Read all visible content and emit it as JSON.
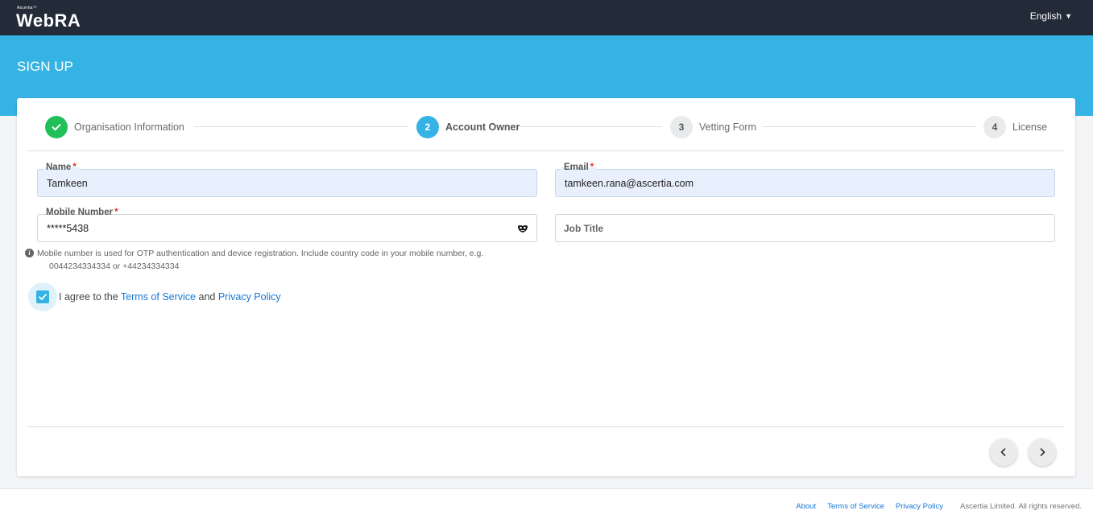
{
  "header": {
    "brand_small": "Ascertia™",
    "brand_web": "Web",
    "brand_ra": "RA",
    "language": "English"
  },
  "banner": {
    "title": "SIGN UP"
  },
  "stepper": {
    "steps": [
      {
        "number": "",
        "label": "Organisation Information",
        "state": "done"
      },
      {
        "number": "2",
        "label": "Account Owner",
        "state": "active"
      },
      {
        "number": "3",
        "label": "Vetting Form",
        "state": "pending"
      },
      {
        "number": "4",
        "label": "License",
        "state": "pending"
      }
    ]
  },
  "form": {
    "name": {
      "label": "Name",
      "required": "*",
      "value": "Tamkeen"
    },
    "email": {
      "label": "Email",
      "required": "*",
      "value": "tamkeen.rana@ascertia.com"
    },
    "mobile": {
      "label": "Mobile Number",
      "required": "*",
      "value": "*****5438"
    },
    "job_title": {
      "placeholder": "Job Title"
    },
    "mobile_hint_line1": "Mobile number is used for OTP authentication and device registration. Include country code in your mobile number, e.g.",
    "mobile_hint_line2": "0044234334334 or +44234334334",
    "agree": {
      "prefix": "I agree to the",
      "terms": "Terms of Service",
      "and": "and",
      "privacy": "Privacy Policy",
      "checked": true
    }
  },
  "footer": {
    "about": "About",
    "terms": "Terms of Service",
    "privacy": "Privacy Policy",
    "copyright": "Ascertia Limited. All rights reserved."
  },
  "colors": {
    "topbar": "#232b39",
    "banner": "#35b3e4",
    "step_done": "#21c05a",
    "step_active": "#35b3e4",
    "link": "#1878d4",
    "required": "#e0362c"
  }
}
